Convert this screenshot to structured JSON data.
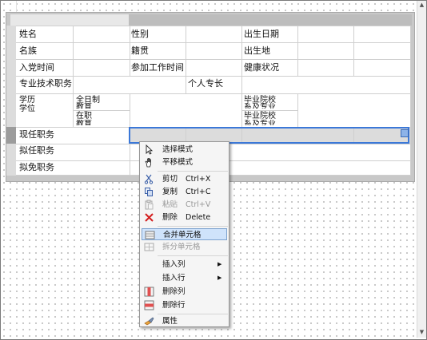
{
  "table": {
    "row1": {
      "name_label": "姓名",
      "gender_label": "性别",
      "birth_label": "出生日期"
    },
    "row2": {
      "ethnicity_label": "名族",
      "native_label": "籍贯",
      "birthplace_label": "出生地"
    },
    "row3": {
      "party_label": "入党时间",
      "work_label": "参加工作时间",
      "health_label": "健康状况"
    },
    "row4": {
      "title_label": "专业技术职务",
      "specialty_label": "个人专长"
    },
    "row5": {
      "degree_label": [
        "学历",
        "学位"
      ],
      "fulltime_label": [
        "全日制",
        "教育"
      ],
      "parttime_label": [
        "在职",
        "教育"
      ],
      "school1_label": [
        "毕业院校",
        "系及专业"
      ],
      "school2_label": [
        "毕业院校",
        "系及专业"
      ]
    },
    "row6": {
      "current_label": "现任职务"
    },
    "row7": {
      "proposed_label": "拟任职务"
    },
    "row8": {
      "remove_label": "拟免职务"
    }
  },
  "context_menu": {
    "items": [
      {
        "icon": "cursor-arrow-icon",
        "label": "选择模式",
        "shortcut": "",
        "enabled": true
      },
      {
        "icon": "hand-icon",
        "label": "平移模式",
        "shortcut": "",
        "enabled": true
      },
      {
        "icon": "scissors-icon",
        "label": "剪切",
        "shortcut": "Ctrl+X",
        "enabled": true
      },
      {
        "icon": "copy-icon",
        "label": "复制",
        "shortcut": "Ctrl+C",
        "enabled": true
      },
      {
        "icon": "paste-icon",
        "label": "粘贴",
        "shortcut": "Ctrl+V",
        "enabled": false
      },
      {
        "icon": "delete-x-icon",
        "label": "删除",
        "shortcut": "Delete",
        "enabled": true
      },
      {
        "icon": "merge-cells-icon",
        "label": "合并单元格",
        "shortcut": "",
        "enabled": true,
        "highlighted": true
      },
      {
        "icon": "split-cells-icon",
        "label": "拆分单元格",
        "shortcut": "",
        "enabled": false
      },
      {
        "icon": "",
        "label": "插入列",
        "shortcut": "",
        "enabled": true,
        "submenu": true
      },
      {
        "icon": "",
        "label": "插入行",
        "shortcut": "",
        "enabled": true,
        "submenu": true
      },
      {
        "icon": "delete-column-icon",
        "label": "删除列",
        "shortcut": "",
        "enabled": true
      },
      {
        "icon": "delete-row-icon",
        "label": "删除行",
        "shortcut": "",
        "enabled": true
      },
      {
        "icon": "properties-icon",
        "label": "属性",
        "shortcut": "",
        "enabled": true
      }
    ]
  },
  "colors": {
    "selection": "#3b78d8",
    "menu_highlight": "#cfe3fb",
    "delete_red": "#d42020"
  }
}
